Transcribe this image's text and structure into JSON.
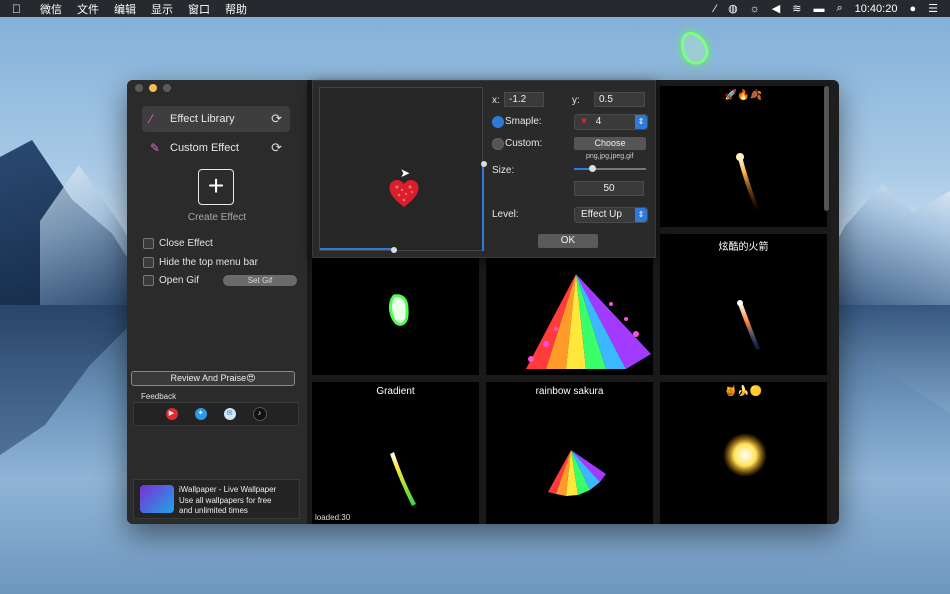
{
  "menubar": {
    "apple": "",
    "items": [
      "微信",
      "文件",
      "编辑",
      "显示",
      "窗口",
      "帮助"
    ],
    "clock": "10:40:20"
  },
  "sidebar": {
    "effect_library": "Effect Library",
    "custom_effect": "Custom Effect",
    "create_effect": "Create Effect",
    "close_effect": "Close Effect",
    "hide_menu_bar": "Hide the top menu bar",
    "open_gif": "Open Gif",
    "set_gif": "Set Gif",
    "review": "Review And Praise😍",
    "feedback": "Feedback",
    "promo_lines": [
      "iWallpaper - Live Wallpaper",
      "Use all wallpapers for free",
      "and unlimited times"
    ]
  },
  "popup": {
    "x_label": "x:",
    "x_value": "-1.2",
    "y_label": "y:",
    "y_value": "0.5",
    "sample_label": "Smaple:",
    "sample_value": "4",
    "custom_label": "Custom:",
    "choose": "Choose",
    "formats": "png,jpg,jpeg,gif",
    "size_label": "Size:",
    "size_value": "50",
    "size_fraction": 0.25,
    "level_label": "Level:",
    "level_value": "Effect Up",
    "ok": "OK"
  },
  "grid": {
    "tile_top_right": "🚀🔥🍂",
    "tile_rocket": "炫酷的火箭",
    "tile_gradient": "Gradient",
    "tile_rainbow": "rainbow sakura",
    "tile_sun": "🍯🍌🟡",
    "loaded": "loaded:30"
  },
  "colors": {
    "accent": "#2f7ad9",
    "icon_pink": "#e26ad6"
  }
}
